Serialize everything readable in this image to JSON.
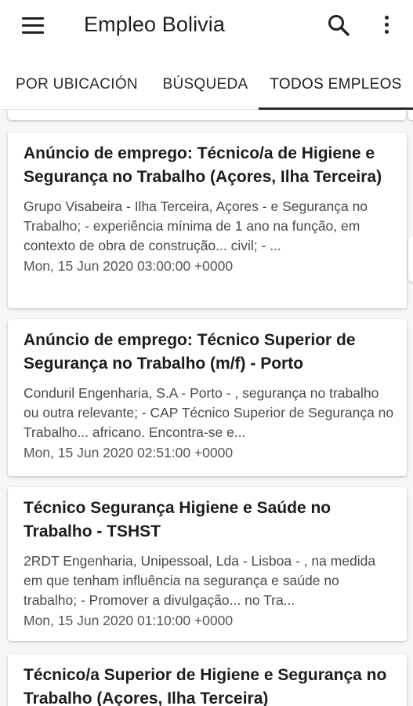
{
  "app": {
    "title": "Empleo Bolivia"
  },
  "icons": {
    "menu": "menu-icon",
    "search": "search-icon",
    "more": "more-vert-icon"
  },
  "tabs": [
    {
      "label": "POR UBICACIÓN",
      "active": false
    },
    {
      "label": "BÚSQUEDA",
      "active": false
    },
    {
      "label": "TODOS EMPLEOS",
      "active": true
    }
  ],
  "jobs": [
    {
      "title": "Anúncio de emprego: Técnico/a de Higiene e Segurança no Trabalho (Açores, Ilha Terceira)",
      "description": "Grupo Visabeira - Ilha Terceira, Açores - e Segurança no Trabalho; - experiência mínima de 1 ano na função, em contexto de obra de construção... civil; - ...",
      "date": "Mon, 15 Jun 2020 03:00:00 +0000"
    },
    {
      "title": "Anúncio de emprego: Técnico Superior de Segurança no Trabalho (m/f) - Porto",
      "description": "Conduril Engenharia, S.A - Porto - , segurança no trabalho ou outra relevante; - CAP Técnico Superior de Segurança no Trabalho... africano. Encontra-se e...",
      "date": "Mon, 15 Jun 2020 02:51:00 +0000"
    },
    {
      "title": "Técnico Segurança Higiene e Saúde no Trabalho - TSHST",
      "description": "2RDT Engenharia, Unipessoal, Lda - Lisboa - , na medida em que tenham influência na segurança e saúde no trabalho; - Promover a divulgação... no Tra...",
      "date": "Mon, 15 Jun 2020 01:10:00 +0000"
    },
    {
      "title": "Técnico/a Superior de Higiene e Segurança no Trabalho (Açores, Ilha Terceira)",
      "description": "",
      "date": ""
    }
  ],
  "colors": {
    "background": "#ffffff",
    "list_background": "#f6f6f6",
    "indicator": "#2a2a2a"
  }
}
